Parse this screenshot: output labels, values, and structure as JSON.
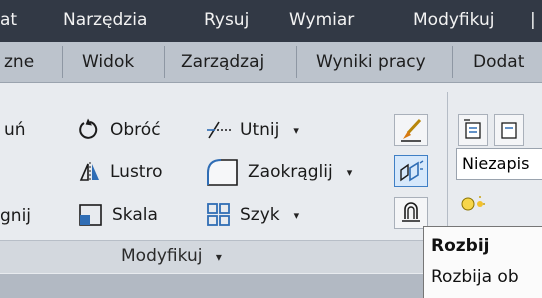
{
  "menu": {
    "items": [
      {
        "label": "at"
      },
      {
        "label": "Narzędzia"
      },
      {
        "label": "Rysuj"
      },
      {
        "label": "Wymiar"
      },
      {
        "label": "Modyfikuj"
      },
      {
        "label": "|"
      }
    ]
  },
  "tabs": {
    "items": [
      {
        "label": "zne"
      },
      {
        "label": "Widok"
      },
      {
        "label": "Zarządzaj"
      },
      {
        "label": "Wyniki pracy"
      },
      {
        "label": "Dodat"
      }
    ]
  },
  "modify_panel": {
    "col1_cut": [
      "uń",
      "gnij"
    ],
    "rotate": "Obróć",
    "mirror": "Lustro",
    "scale": "Skala",
    "trim": "Utnij",
    "fillet": "Zaokrąglij",
    "array": "Szyk",
    "caret": "▾",
    "title": "Modyfikuj",
    "title_caret": "▾"
  },
  "layer_panel": {
    "layer_combo_value": "Niezapis"
  },
  "tooltip": {
    "title": "Rozbij",
    "description": "Rozbija ob"
  },
  "colors": {
    "menubar_bg": "#323945",
    "tabbar_bg": "#bcc3cc",
    "ribbon_bg": "#e8ebef",
    "active_tool_border": "#3f7fc5",
    "icon_blue": "#2f6db5"
  }
}
